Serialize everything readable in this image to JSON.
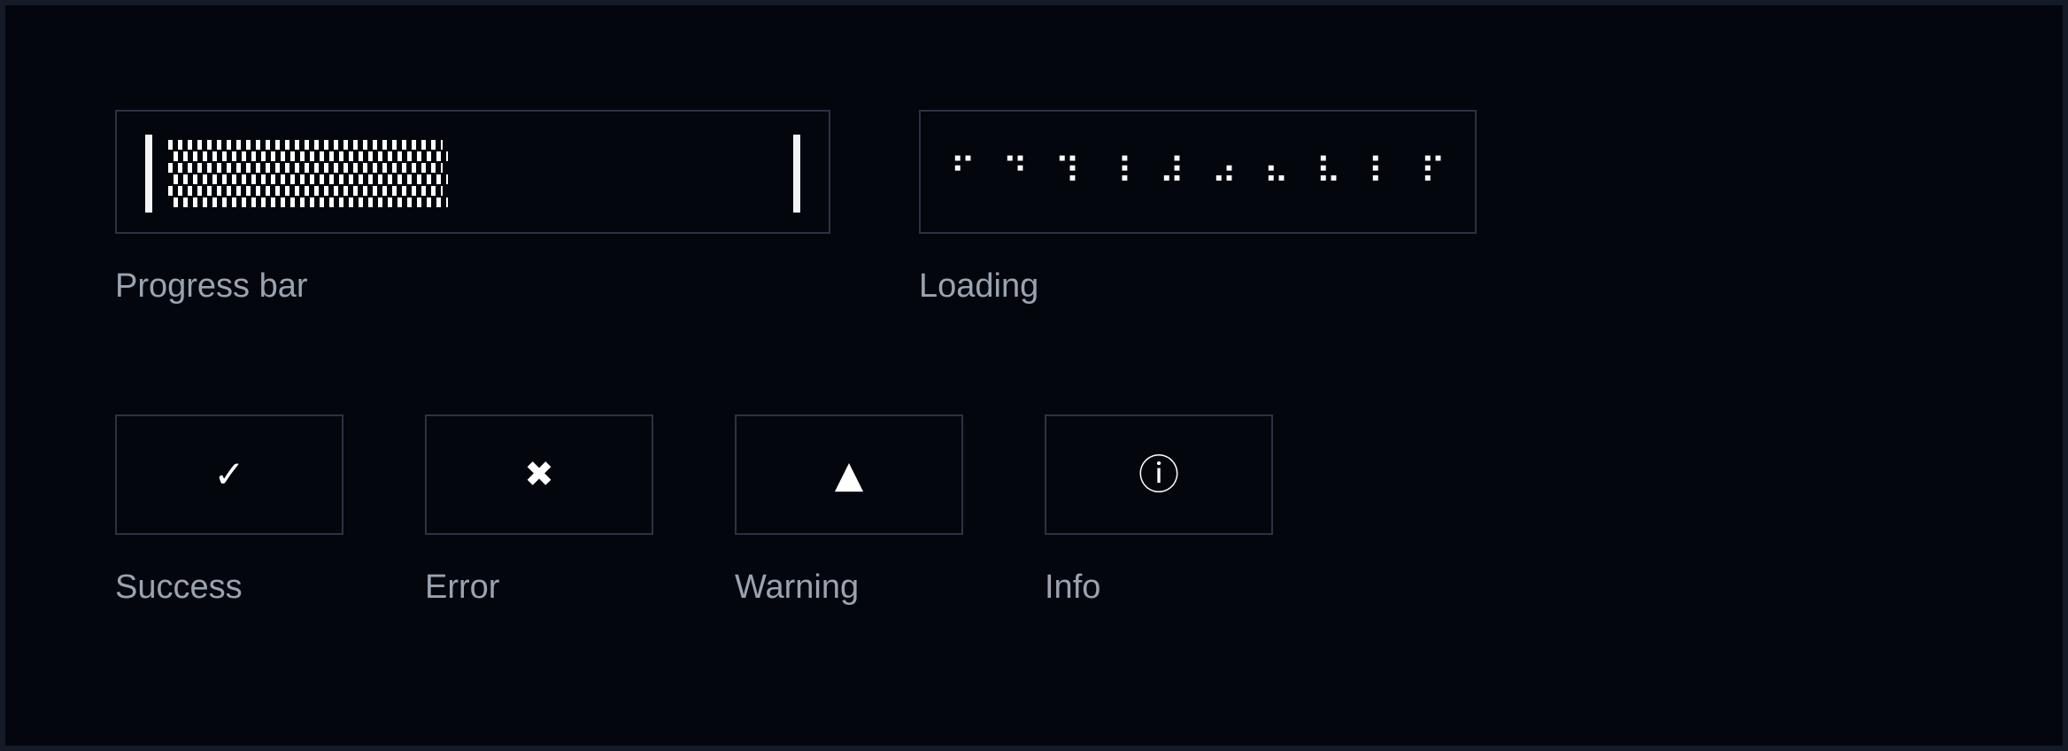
{
  "theme": {
    "page_background": "#03060d",
    "page_border": "#141a26",
    "box_border": "#2b3242",
    "caption_color": "#9aa3b0",
    "glyph_color": "#ffffff",
    "fill_color": "#ffffff"
  },
  "widgets": {
    "progress": {
      "caption": "Progress bar",
      "percent": 45,
      "left_cap": "|",
      "right_cap": "|",
      "fill_glyph": "hatch-brick-pattern"
    },
    "loading": {
      "caption": "Loading",
      "frames": [
        "⠋",
        "⠙",
        "⠹",
        "⠸",
        "⠼",
        "⠴",
        "⠦",
        "⠧",
        "⠇",
        "⠏"
      ]
    }
  },
  "statuses": [
    {
      "caption": "Success",
      "glyph": "✓",
      "icon_name": "check-icon",
      "glyph_class": "g-check"
    },
    {
      "caption": "Error",
      "glyph": "✖",
      "icon_name": "cross-icon",
      "glyph_class": "g-cross"
    },
    {
      "caption": "Warning",
      "glyph": "▲",
      "icon_name": "triangle-icon",
      "glyph_class": "g-warning"
    },
    {
      "caption": "Info",
      "glyph": "ⓘ",
      "icon_name": "info-icon",
      "glyph_class": "g-info"
    }
  ]
}
